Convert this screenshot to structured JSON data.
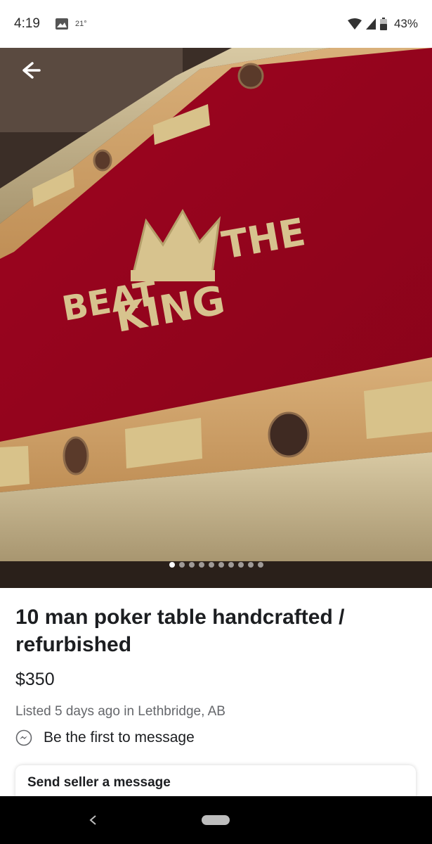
{
  "status_bar": {
    "time": "4:19",
    "temperature": "21°",
    "battery": "43%",
    "icons": [
      "image-icon",
      "wifi-icon",
      "cell-signal-icon",
      "battery-icon"
    ]
  },
  "hero": {
    "sign_text": {
      "beat": "BEAT",
      "the": "THE",
      "king": "KING"
    },
    "carousel_total": 10,
    "carousel_active_index": 0,
    "colors": {
      "felt": "#a0061e",
      "rail": "#c9a067",
      "padding": "#cdbb93"
    }
  },
  "listing": {
    "title": "10 man poker table handcrafted / refurbished",
    "price": "$350",
    "meta": "Listed 5 days ago in Lethbridge, AB",
    "messenger_prompt": "Be the first to message",
    "message_card_title": "Send seller a message"
  },
  "nav": {
    "icons": [
      "back-triangle-icon",
      "home-pill-icon"
    ]
  }
}
